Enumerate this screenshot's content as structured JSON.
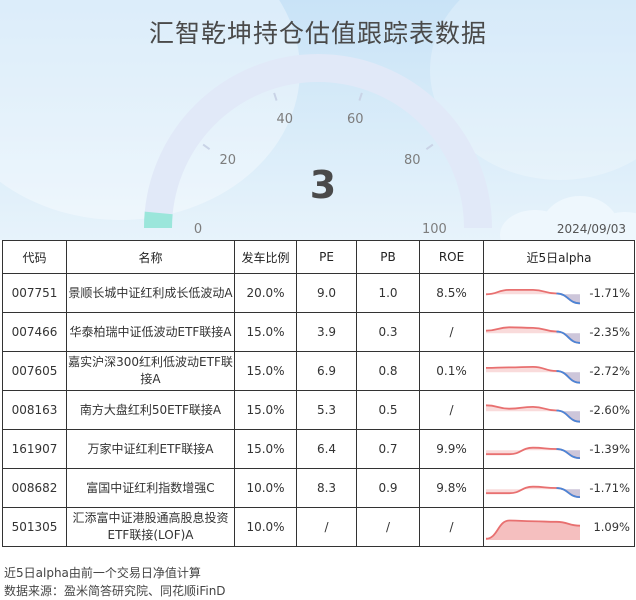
{
  "title": "汇智乾坤持仓估值跟踪表数据",
  "gauge": {
    "value": 3,
    "min": 0,
    "max": 100,
    "ticks": [
      "0",
      "20",
      "40",
      "60",
      "80",
      "100"
    ]
  },
  "date": "2024/09/03",
  "table": {
    "headers": [
      "代码",
      "名称",
      "发车比例",
      "PE",
      "PB",
      "ROE",
      "近5日alpha"
    ],
    "rows": [
      {
        "code": "007751",
        "name": "景顺长城中证红利成长低波动A",
        "ratio": "20.0%",
        "pe": "9.0",
        "pb": "1.0",
        "roe": "8.5%",
        "alpha": "-1.71%",
        "spark": [
          0.45,
          0.62,
          0.62,
          0.48,
          0.1
        ],
        "color": "blue"
      },
      {
        "code": "007466",
        "name": "华泰柏瑞中证低波动ETF联接A",
        "ratio": "15.0%",
        "pe": "3.9",
        "pb": "0.3",
        "roe": "/",
        "alpha": "-2.35%",
        "spark": [
          0.55,
          0.68,
          0.66,
          0.52,
          0.08
        ],
        "color": "blue"
      },
      {
        "code": "007605",
        "name": "嘉实沪深300红利低波动ETF联接A",
        "ratio": "15.0%",
        "pe": "6.9",
        "pb": "0.8",
        "roe": "0.1%",
        "alpha": "-2.72%",
        "spark": [
          0.62,
          0.64,
          0.66,
          0.5,
          0.05
        ],
        "color": "blue"
      },
      {
        "code": "008163",
        "name": "南方大盘红利50ETF联接A",
        "ratio": "15.0%",
        "pe": "5.3",
        "pb": "0.5",
        "roe": "/",
        "alpha": "-2.60%",
        "spark": [
          0.68,
          0.55,
          0.62,
          0.48,
          0.05
        ],
        "color": "blue"
      },
      {
        "code": "161907",
        "name": "万家中证红利ETF联接A",
        "ratio": "15.0%",
        "pe": "6.4",
        "pb": "0.7",
        "roe": "9.9%",
        "alpha": "-1.39%",
        "spark": [
          0.3,
          0.3,
          0.55,
          0.5,
          0.15
        ],
        "color": "blue"
      },
      {
        "code": "008682",
        "name": "富国中证红利指数增强C",
        "ratio": "10.0%",
        "pe": "8.3",
        "pb": "0.9",
        "roe": "9.8%",
        "alpha": "-1.71%",
        "spark": [
          0.3,
          0.3,
          0.55,
          0.5,
          0.15
        ],
        "color": "blue"
      },
      {
        "code": "501305",
        "name": "汇添富中证港股通高股息投资ETF联接(LOF)A",
        "ratio": "10.0%",
        "pe": "/",
        "pb": "/",
        "roe": "/",
        "alpha": "1.09%",
        "spark": [
          0.05,
          0.75,
          0.72,
          0.7,
          0.55
        ],
        "color": "red"
      }
    ]
  },
  "footnotes": [
    "近5日alpha由前一个交易日净值计算",
    "数据来源：盈米简答研究院、同花顺iFinD"
  ],
  "colors": {
    "gauge_track": "#dfe8f7",
    "gauge_fill": "#8fe3d6",
    "spark_pos": "#e87070",
    "spark_neg": "#4a86d8"
  }
}
